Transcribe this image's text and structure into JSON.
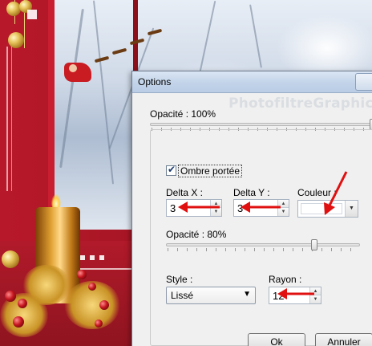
{
  "background": {
    "watermark": "PhotofiltreGraphic"
  },
  "dialog": {
    "title": "Options",
    "opacity_label": "Opacité : 100%",
    "opacity_value": 100,
    "shadow": {
      "checkbox_label": "Ombre portée",
      "checked": true,
      "delta_x_label": "Delta X :",
      "delta_x_value": "3",
      "delta_y_label": "Delta Y :",
      "delta_y_value": "3",
      "color_label": "Couleur :",
      "color_value": "#ffffff",
      "opacity_label": "Opacité : 80%",
      "opacity_value": 80,
      "style_label": "Style :",
      "style_value": "Lissé",
      "radius_label": "Rayon :",
      "radius_value": "12"
    },
    "buttons": {
      "ok": "Ok",
      "cancel": "Annuler"
    }
  },
  "icons": {
    "annotation": "red-arrow-icon",
    "spin": "spin-arrows-icon",
    "dropdown": "chevron-down-icon"
  },
  "colors": {
    "annotation_red": "#e01010",
    "titlebar": "#c4d5ea"
  }
}
